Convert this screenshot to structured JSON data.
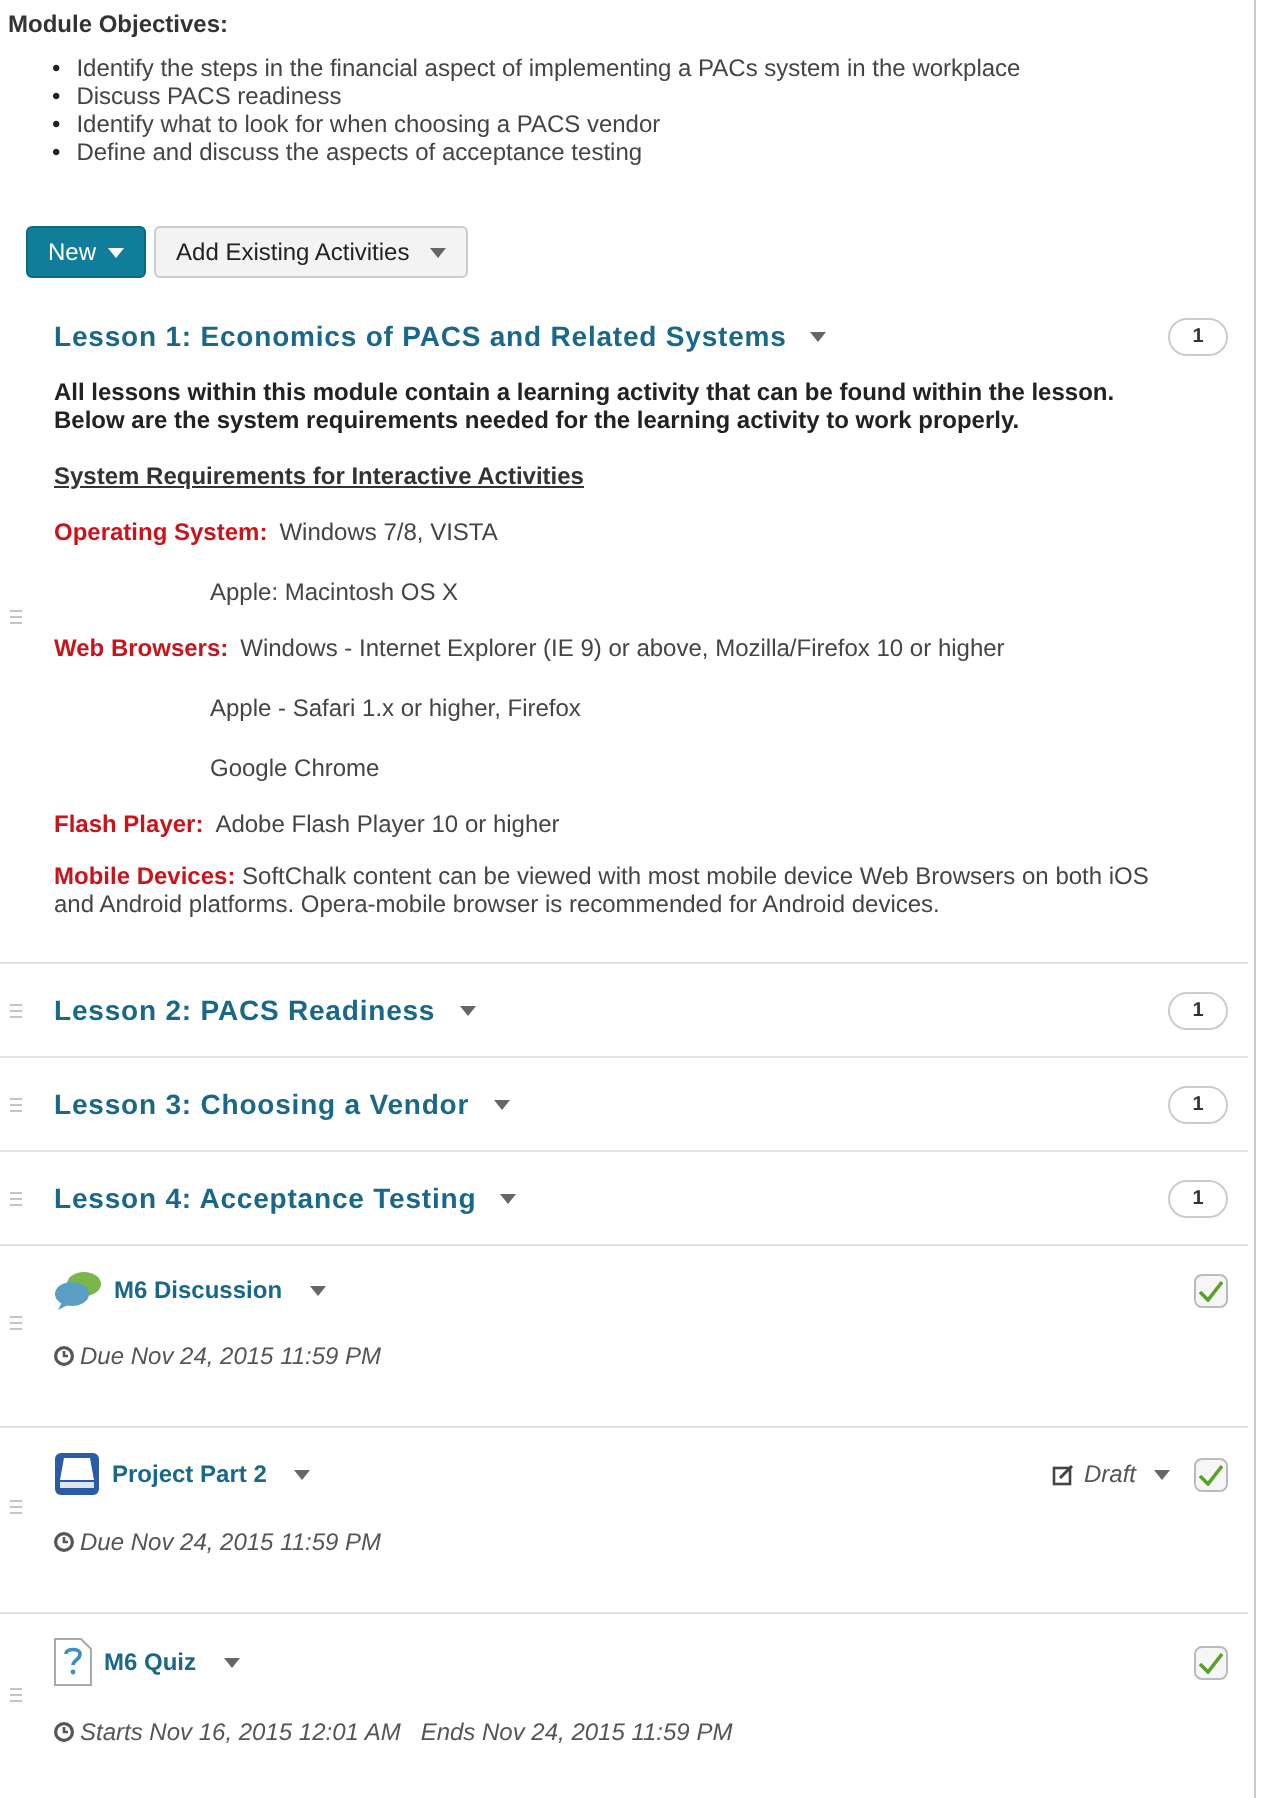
{
  "objectives": {
    "title": "Module Objectives:",
    "bullet": "•",
    "items": [
      "Identify the steps in the financial aspect of implementing a PACs system in the workplace",
      "Discuss PACS readiness",
      "Identify what to look for when choosing a PACS vendor",
      "Define and discuss the aspects of acceptance testing"
    ]
  },
  "toolbar": [
    {
      "label": "New",
      "kind": "primary"
    },
    {
      "label": "Add Existing Activities",
      "kind": "default"
    }
  ],
  "lessons": [
    {
      "title": "Lesson 1: Economics of PACS and Related Systems",
      "count": "1",
      "expanded": true,
      "intro": "All lessons within this module contain a learning activity that can be found within the lesson. Below are the system requirements needed for the learning activity to work properly.",
      "requirements_title": "System Requirements for Interactive Activities",
      "requirements": [
        {
          "kind": "lines",
          "label": "Operating System:",
          "lines": [
            "Windows 7/8, VISTA",
            "Apple: Macintosh OS X"
          ]
        },
        {
          "kind": "lines",
          "label": "Web Browsers:",
          "lines": [
            "Windows - Internet Explorer (IE 9) or above, Mozilla/Firefox 10 or higher",
            "Apple - Safari 1.x or higher, Firefox",
            "Google Chrome"
          ]
        },
        {
          "kind": "lines",
          "label": "Flash Player:",
          "lines": [
            "Adobe Flash Player 10 or higher"
          ]
        },
        {
          "kind": "paragraph",
          "label": "Mobile Devices:",
          "lines": [
            "SoftChalk content can be viewed with most mobile device Web Browsers on both iOS and Android platforms.  Opera-mobile browser is recommended for Android devices."
          ]
        }
      ]
    },
    {
      "title": "Lesson 2: PACS Readiness",
      "count": "1",
      "expanded": false
    },
    {
      "title": "Lesson 3: Choosing a Vendor",
      "count": "1",
      "expanded": false
    },
    {
      "title": "Lesson 4: Acceptance Testing",
      "count": "1",
      "expanded": false
    }
  ],
  "activities": [
    {
      "kind": "discussion",
      "title": "M6 Discussion",
      "dates": "Due Nov 24, 2015 11:59 PM",
      "checked": true
    },
    {
      "kind": "assignment",
      "title": "Project Part 2",
      "status": "Draft",
      "dates": "Due Nov 24, 2015 11:59 PM",
      "checked": true
    },
    {
      "kind": "quiz",
      "title": "M6 Quiz",
      "dates": "Starts Nov 16, 2015 12:01 AM   Ends Nov 24, 2015 11:59 PM",
      "checked": true
    }
  ]
}
